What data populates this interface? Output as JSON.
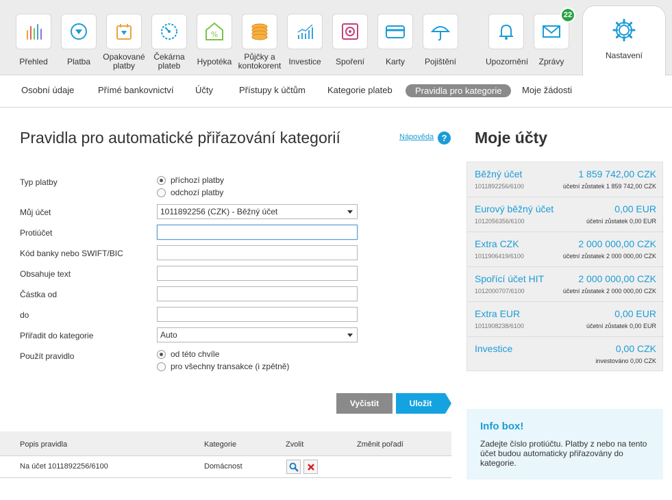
{
  "nav": {
    "items": [
      {
        "label": "Přehled",
        "icon": "bar-chart-icon"
      },
      {
        "label": "Platba",
        "icon": "payment-icon"
      },
      {
        "label": "Opakované platby",
        "icon": "calendar-icon"
      },
      {
        "label": "Čekárna plateb",
        "icon": "gauge-icon"
      },
      {
        "label": "Hypotéka",
        "icon": "house-percent-icon"
      },
      {
        "label": "Půjčky a kontokorent",
        "icon": "coins-icon"
      },
      {
        "label": "Investice",
        "icon": "investment-chart-icon"
      },
      {
        "label": "Spoření",
        "icon": "safe-icon"
      },
      {
        "label": "Karty",
        "icon": "card-icon"
      },
      {
        "label": "Pojištění",
        "icon": "umbrella-icon"
      },
      {
        "label": "Upozornění",
        "icon": "bell-icon"
      },
      {
        "label": "Zprávy",
        "icon": "envelope-icon",
        "badge": "22"
      }
    ],
    "settings": {
      "label": "Nastavení",
      "icon": "gear-icon"
    },
    "accent": "#1a9cd6"
  },
  "subnav": {
    "items": [
      "Osobní údaje",
      "Přímé bankovnictví",
      "Účty",
      "Přístupy k účtům",
      "Kategorie plateb",
      "Pravidla pro kategorie",
      "Moje žádosti"
    ],
    "active": "Pravidla pro kategorie"
  },
  "main": {
    "title": "Pravidla pro automatické přiřazování kategorií",
    "help": "Nápověda",
    "help_symbol": "?"
  },
  "form": {
    "payment_type": {
      "label": "Typ platby",
      "options": [
        "příchozí platby",
        "odchozí platby"
      ],
      "selected": "příchozí platby"
    },
    "my_account": {
      "label": "Můj účet",
      "value": "1011892256 (CZK) - Běžný účet"
    },
    "counter_account": {
      "label": "Protiúčet",
      "value": ""
    },
    "bank_code": {
      "label": "Kód banky nebo SWIFT/BIC",
      "value": ""
    },
    "contains_text": {
      "label": "Obsahuje text",
      "value": ""
    },
    "amount_from": {
      "label": "Částka od",
      "value": ""
    },
    "amount_to": {
      "label": "do",
      "value": ""
    },
    "category": {
      "label": "Přiřadit do kategorie",
      "value": "Auto"
    },
    "apply_rule": {
      "label": "Použít pravidlo",
      "options": [
        "od této chvíle",
        "pro všechny transakce (i zpětně)"
      ],
      "selected": "od této chvíle"
    },
    "clear_label": "Vyčistit",
    "save_label": "Uložit"
  },
  "rules_table": {
    "columns": [
      "Popis pravidla",
      "Kategorie",
      "Zvolit",
      "Změnit pořadí"
    ],
    "rows": [
      {
        "description": "Na účet 1011892256/6100",
        "category": "Domácnost"
      }
    ]
  },
  "accounts": {
    "title": "Moje účty",
    "items": [
      {
        "name": "Běžný účet",
        "amount": "1 859 742,00 CZK",
        "number": "1011892256/6100",
        "balance": "účetní zůstatek 1 859 742,00 CZK"
      },
      {
        "name": "Eurový běžný účet",
        "amount": "0,00 EUR",
        "number": "1012056356/6100",
        "balance": "účetní zůstatek 0,00 EUR"
      },
      {
        "name": "Extra CZK",
        "amount": "2 000 000,00 CZK",
        "number": "1011906419/6100",
        "balance": "účetní zůstatek 2 000 000,00 CZK"
      },
      {
        "name": "Spořící účet HIT",
        "amount": "2 000 000,00 CZK",
        "number": "1012000707/6100",
        "balance": "účetní zůstatek 2 000 000,00 CZK"
      },
      {
        "name": "Extra EUR",
        "amount": "0,00 EUR",
        "number": "1011908238/6100",
        "balance": "účetní zůstatek 0,00 EUR"
      },
      {
        "name": "Investice",
        "amount": "0,00 CZK",
        "number": "",
        "balance": "investováno 0,00 CZK"
      }
    ]
  },
  "info_box": {
    "title": "Info box!",
    "text": "Zadejte číslo protiúčtu. Platby z nebo na tento účet budou automaticky přiřazovány do kategorie."
  }
}
